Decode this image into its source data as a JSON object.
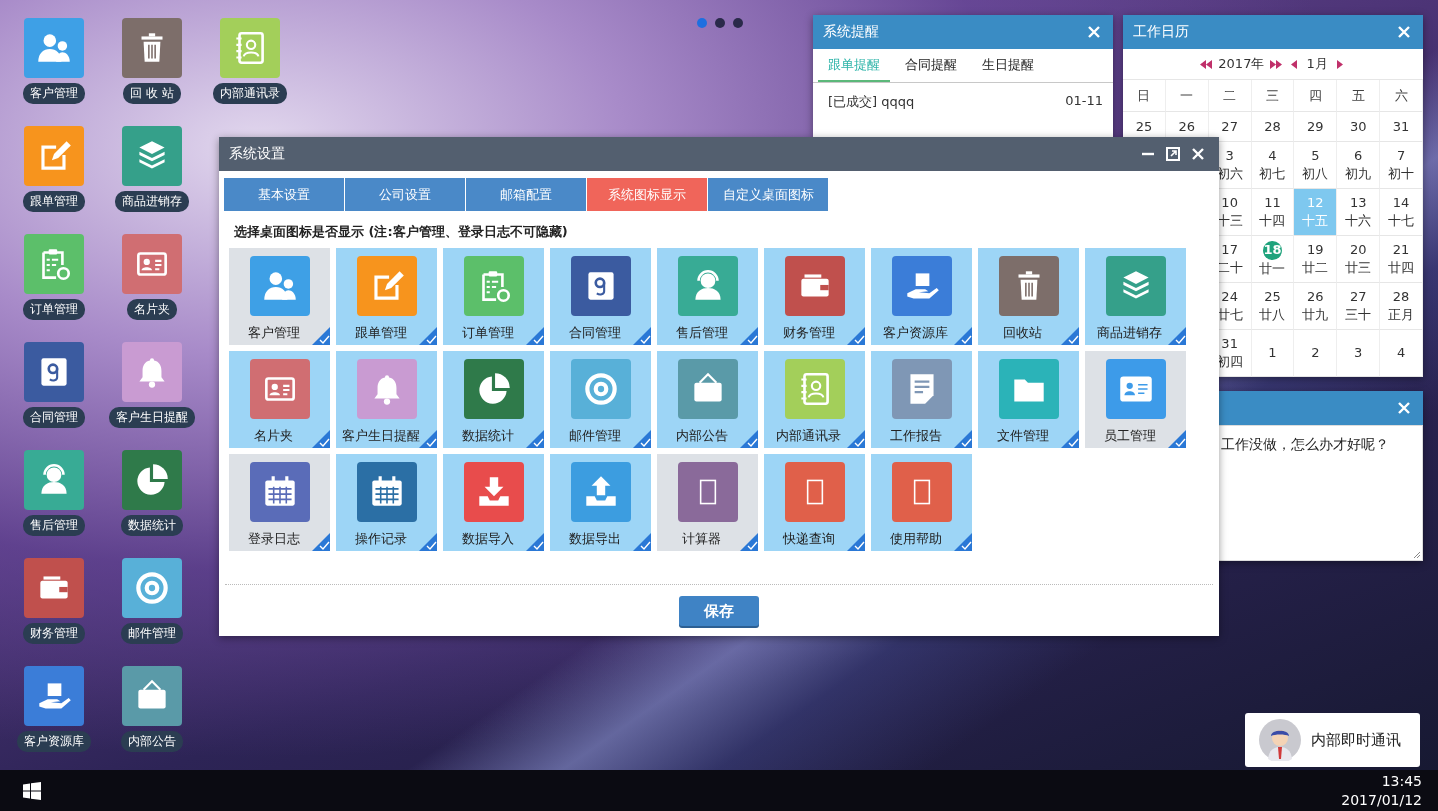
{
  "desktop_icons": [
    {
      "label": "客户管理",
      "color": "#3ea0e6"
    },
    {
      "label": "跟单管理",
      "color": "#f7941d"
    },
    {
      "label": "订单管理",
      "color": "#5cbf6a"
    },
    {
      "label": "合同管理",
      "color": "#3b5ba0"
    },
    {
      "label": "售后管理",
      "color": "#38ab95"
    },
    {
      "label": "财务管理",
      "color": "#c0504d"
    },
    {
      "label": "客户资源库",
      "color": "#3b7dd8"
    },
    {
      "label": "回 收 站",
      "color": "#7d6e6a"
    },
    {
      "label": "商品进销存",
      "color": "#35a08a"
    },
    {
      "label": "名片夹",
      "color": "#d06e72"
    },
    {
      "label": "客户生日提醒",
      "color": "#c99bd2"
    },
    {
      "label": "数据统计",
      "color": "#2f7a4a"
    },
    {
      "label": "邮件管理",
      "color": "#58b0d8"
    },
    {
      "label": "内部公告",
      "color": "#5a9aa8"
    },
    {
      "label": "内部通讯录",
      "color": "#a3cf5a"
    }
  ],
  "page_dots": [
    {
      "selected": true
    },
    {
      "selected": false
    },
    {
      "selected": false
    }
  ],
  "reminder_window": {
    "title": "系统提醒",
    "tabs": [
      {
        "label": "跟单提醒",
        "selected": true
      },
      {
        "label": "合同提醒",
        "selected": false
      },
      {
        "label": "生日提醒",
        "selected": false
      }
    ],
    "items": [
      {
        "text": "[已成交] qqqq",
        "date": "01-11"
      }
    ]
  },
  "calendar": {
    "title": "工作日历",
    "year": "2017年",
    "month": "1月",
    "weekdays": [
      "日",
      "一",
      "二",
      "三",
      "四",
      "五",
      "六"
    ],
    "weeks": [
      [
        {
          "day": "25",
          "selected": false,
          "today": false
        },
        {
          "day": "26",
          "selected": false,
          "today": false
        },
        {
          "day": "27",
          "selected": false,
          "today": false
        },
        {
          "day": "28",
          "selected": false,
          "today": false
        },
        {
          "day": "29",
          "selected": false,
          "today": false
        },
        {
          "day": "30",
          "selected": false,
          "today": false
        },
        {
          "day": "31",
          "selected": false,
          "today": false
        }
      ],
      [
        {
          "day": "3",
          "lunar": "初六",
          "selected": false,
          "today": false
        },
        {
          "day": "4",
          "lunar": "初七",
          "selected": false,
          "today": false
        },
        {
          "day": "5",
          "lunar": "初八",
          "selected": false,
          "today": false
        },
        {
          "day": "6",
          "lunar": "初九",
          "selected": false,
          "today": false
        },
        {
          "day": "7",
          "lunar": "初十",
          "selected": false,
          "today": false
        }
      ],
      [
        {
          "day": "10",
          "lunar": "十三",
          "selected": false,
          "today": false
        },
        {
          "day": "11",
          "lunar": "十四",
          "selected": false,
          "today": false
        },
        {
          "day": "12",
          "lunar": "十五",
          "selected": true,
          "today": false
        },
        {
          "day": "13",
          "lunar": "十六",
          "selected": false,
          "today": false
        },
        {
          "day": "14",
          "lunar": "十七",
          "selected": false,
          "today": false
        }
      ],
      [
        {
          "day": "17",
          "lunar": "二十",
          "selected": false,
          "today": false
        },
        {
          "day": "18",
          "lunar": "廿一",
          "selected": false,
          "today": true
        },
        {
          "day": "19",
          "lunar": "廿二",
          "selected": false,
          "today": false
        },
        {
          "day": "20",
          "lunar": "廿三",
          "selected": false,
          "today": false
        },
        {
          "day": "21",
          "lunar": "廿四",
          "selected": false,
          "today": false
        }
      ],
      [
        {
          "day": "24",
          "lunar": "廿七",
          "selected": false,
          "today": false
        },
        {
          "day": "25",
          "lunar": "廿八",
          "selected": false,
          "today": false
        },
        {
          "day": "26",
          "lunar": "廿九",
          "selected": false,
          "today": false
        },
        {
          "day": "27",
          "lunar": "三十",
          "selected": false,
          "today": false
        },
        {
          "day": "28",
          "lunar": "正月",
          "selected": false,
          "today": false
        }
      ],
      [
        {
          "day": "31",
          "lunar": "初四",
          "selected": false,
          "today": false
        },
        {
          "day": "1",
          "selected": false,
          "today": false
        },
        {
          "day": "2",
          "selected": false,
          "today": false
        },
        {
          "day": "3",
          "selected": false,
          "today": false
        },
        {
          "day": "4",
          "selected": false,
          "today": false
        }
      ]
    ]
  },
  "notes_window": {
    "text": "工作没做，怎么办才好呢？"
  },
  "dialog": {
    "title": "系统设置",
    "tabs": [
      {
        "label": "基本设置",
        "selected": false
      },
      {
        "label": "公司设置",
        "selected": false
      },
      {
        "label": "邮箱配置",
        "selected": false
      },
      {
        "label": "系统图标显示",
        "selected": true
      },
      {
        "label": "自定义桌面图标",
        "selected": false
      }
    ],
    "hint": "选择桌面图标是否显示 (注:客户管理、登录日志不可隐藏)",
    "tiles": [
      {
        "label": "客户管理",
        "color": "#3ea0e6",
        "selected": false,
        "checked": true
      },
      {
        "label": "跟单管理",
        "color": "#f7941d",
        "selected": true,
        "checked": true
      },
      {
        "label": "订单管理",
        "color": "#5cbf6a",
        "selected": true,
        "checked": true
      },
      {
        "label": "合同管理",
        "color": "#3b5ba0",
        "selected": true,
        "checked": true
      },
      {
        "label": "售后管理",
        "color": "#38ab95",
        "selected": true,
        "checked": true
      },
      {
        "label": "财务管理",
        "color": "#c0504d",
        "selected": true,
        "checked": true
      },
      {
        "label": "客户资源库",
        "color": "#3b7dd8",
        "selected": true,
        "checked": true
      },
      {
        "label": "回收站",
        "color": "#7d6e6a",
        "selected": true,
        "checked": true
      },
      {
        "label": "商品进销存",
        "color": "#35a08a",
        "selected": true,
        "checked": true
      },
      {
        "label": "名片夹",
        "color": "#d06e72",
        "selected": true,
        "checked": true
      },
      {
        "label": "客户生日提醒",
        "color": "#c99bd2",
        "selected": true,
        "checked": true
      },
      {
        "label": "数据统计",
        "color": "#2f7a4a",
        "selected": true,
        "checked": true
      },
      {
        "label": "邮件管理",
        "color": "#58b0d8",
        "selected": true,
        "checked": true
      },
      {
        "label": "内部公告",
        "color": "#5a9aa8",
        "selected": true,
        "checked": true
      },
      {
        "label": "内部通讯录",
        "color": "#a3cf5a",
        "selected": true,
        "checked": true
      },
      {
        "label": "工作报告",
        "color": "#7f97b5",
        "selected": true,
        "checked": true
      },
      {
        "label": "文件管理",
        "color": "#2bb3b8",
        "selected": true,
        "checked": true
      },
      {
        "label": "员工管理",
        "color": "#3d9be9",
        "selected": false,
        "checked": true
      },
      {
        "label": "登录日志",
        "color": "#5a6cb8",
        "selected": false,
        "checked": true
      },
      {
        "label": "操作记录",
        "color": "#2b6fa5",
        "selected": true,
        "checked": true
      },
      {
        "label": "数据导入",
        "color": "#e84c4c",
        "selected": true,
        "checked": true
      },
      {
        "label": "数据导出",
        "color": "#3c9de0",
        "selected": true,
        "checked": true
      },
      {
        "label": "计算器",
        "color": "#8a6a9a",
        "selected": false,
        "checked": true
      },
      {
        "label": "快递查询",
        "color": "#e0604a",
        "selected": true,
        "checked": true
      },
      {
        "label": "使用帮助",
        "color": "#e0604a",
        "selected": true,
        "checked": true
      }
    ],
    "save_button": "保存"
  },
  "chat_button": {
    "label": "内部即时通讯"
  },
  "taskbar": {
    "time": "13:45",
    "date": "2017/01/12"
  }
}
